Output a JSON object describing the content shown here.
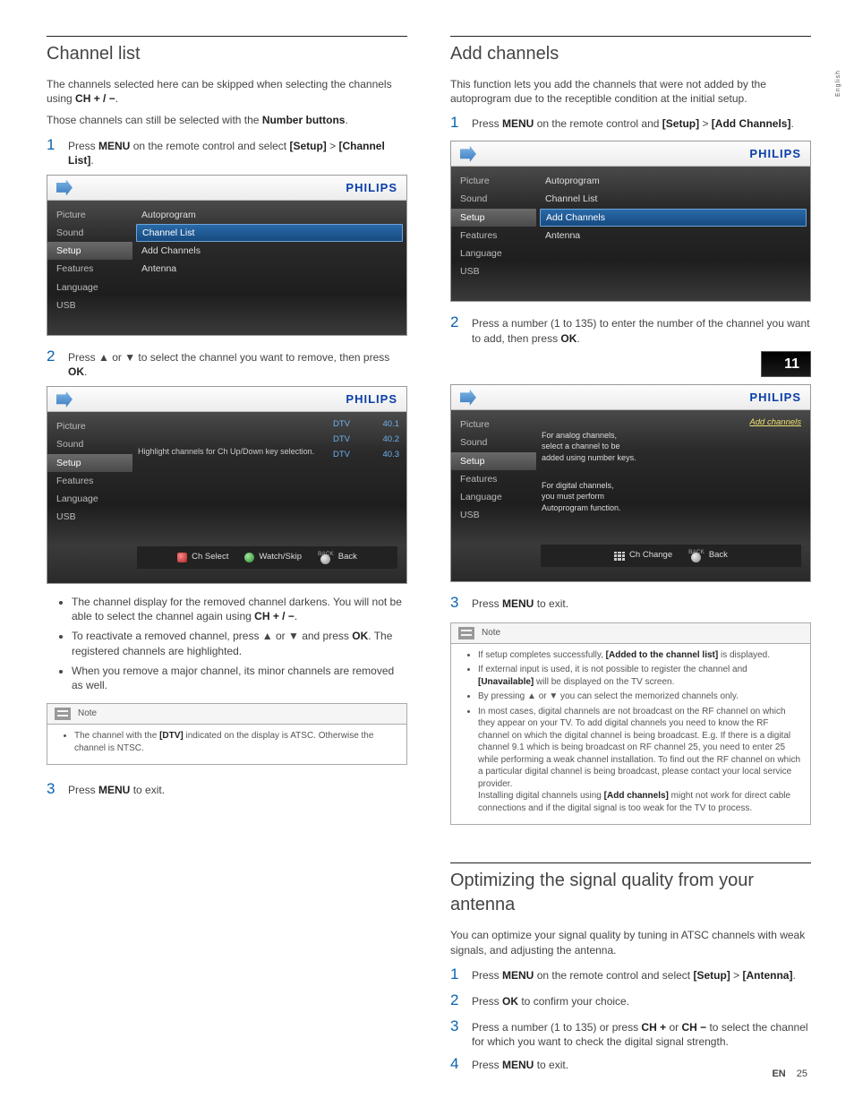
{
  "lang_tab": "English",
  "footer": {
    "lang": "EN",
    "page": "25"
  },
  "menu_items": [
    "Picture",
    "Sound",
    "Setup",
    "Features",
    "Language",
    "USB"
  ],
  "setup_sub": [
    "Autoprogram",
    "Channel List",
    "Add Channels",
    "Antenna"
  ],
  "brand": "PHILIPS",
  "left": {
    "h1": "Channel list",
    "p1a": "The channels selected here can be skipped when selecting the channels using ",
    "p1b": "CH + / −",
    "p1c": ".",
    "p2a": "Those channels can still be selected with the ",
    "p2b": "Number buttons",
    "p2c": ".",
    "s1a": "Press ",
    "s1b": "MENU",
    "s1c": " on the remote control and select ",
    "s1d": "[Setup]",
    "s1e": " > ",
    "s1f": "[Channel List]",
    "s1g": ".",
    "s2a": "Press ▲ or ▼ to select the channel you want to remove, then press ",
    "s2b": "OK",
    "s2c": ".",
    "osd2_hint": "Highlight channels for Ch Up/Down key selection.",
    "osd2_rows": [
      {
        "l": "DTV",
        "r": "40.1"
      },
      {
        "l": "DTV",
        "r": "40.2"
      },
      {
        "l": "DTV",
        "r": "40.3"
      }
    ],
    "osd2_footer": {
      "a": "Ch Select",
      "b": "Watch/Skip",
      "c": "Back",
      "c_tiny": "BACK"
    },
    "bul1a": "The channel display for the removed channel darkens. You will not be able to select the channel again using ",
    "bul1b": "CH + / −",
    "bul1c": ".",
    "bul2a": "To reactivate a removed channel, press ▲ or ▼ and press ",
    "bul2b": "OK",
    "bul2c": ". The registered channels are highlighted.",
    "bul3": "When you remove a major channel, its minor channels are removed as well.",
    "note_h": "Note",
    "note_t1": "The channel with the ",
    "note_t2": "[DTV]",
    "note_t3": " indicated on the display is ATSC. Otherwise the channel is NTSC.",
    "s3a": "Press ",
    "s3b": "MENU",
    "s3c": " to exit."
  },
  "right": {
    "h1": "Add channels",
    "p1": "This function lets you add the channels that were not added by the autoprogram due to the receptible condition at the initial setup.",
    "s1a": "Press ",
    "s1b": "MENU",
    "s1c": " on the remote control and ",
    "s1d": "[Setup]",
    "s1e": " > ",
    "s1f": "[Add Channels]",
    "s1g": ".",
    "s2a": "Press a number (1 to 135) to enter the number of the channel you want to add, then press ",
    "s2b": "OK",
    "s2c": ".",
    "ch_entry": "11",
    "osd3_right": "Add channels",
    "osd3_hint1": "For analog channels,\nselect a channel to be\nadded using number keys.",
    "osd3_hint2": "For digital channels,\nyou must perform\nAutoprogram function.",
    "osd3_footer": {
      "a": "Ch Change",
      "b": "Back",
      "b_tiny": "BACK"
    },
    "s3a": "Press ",
    "s3b": "MENU",
    "s3c": " to exit.",
    "note_h": "Note",
    "note_items": [
      {
        "pre": "If setup completes successfully, ",
        "b": "[Added to the channel list]",
        "post": " is displayed."
      },
      {
        "pre": "If external input is used, it is not possible to register the channel and ",
        "b": "[Unavailable]",
        "post": " will be displayed on the TV screen."
      },
      {
        "plain": "By pressing ▲ or ▼ you can select the memorized channels only."
      },
      {
        "pre": "In most cases, digital channels are not broadcast on the RF channel on which they appear on your TV. To add digital channels you need to know the RF channel on which the digital channel is being broadcast. E.g. If there is a digital channel 9.1 which is being broadcast on RF channel 25, you need to enter 25 while performing a weak channel installation. To find out the RF channel on which a particular digital channel is being broadcast, please contact your local service provider.\nInstalling digital channels using ",
        "b": "[Add channels]",
        "post": " might not work for direct cable connections and if the digital signal is too weak for the TV to process."
      }
    ],
    "h2": "Optimizing the signal quality from your antenna",
    "p2": "You can optimize your signal quality by tuning in ATSC channels with weak signals, and adjusting the antenna.",
    "o1a": "Press ",
    "o1b": "MENU",
    "o1c": " on the remote control and select ",
    "o1d": "[Setup]",
    "o1e": " > ",
    "o1f": "[Antenna]",
    "o1g": ".",
    "o2a": "Press ",
    "o2b": "OK",
    "o2c": " to confirm your choice.",
    "o3a": "Press a number (1 to 135) or press ",
    "o3b": "CH +",
    "o3c": " or ",
    "o3d": "CH −",
    "o3e": " to select the channel for which you want to check the digital signal strength.",
    "o4a": "Press ",
    "o4b": "MENU",
    "o4c": " to exit."
  }
}
